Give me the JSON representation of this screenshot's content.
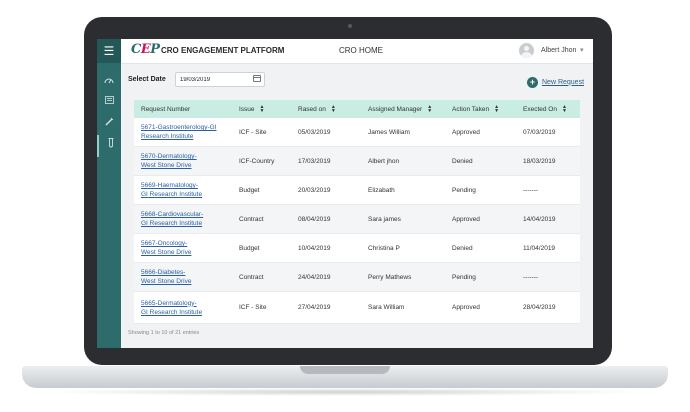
{
  "app": {
    "logo_text": "CEP",
    "brand": "CRO ENGAGEMENT PLATFORM",
    "page_title": "CRO HOME"
  },
  "user": {
    "name": "Albert Jhon"
  },
  "sidebar": {
    "items": [
      {
        "icon": "menu-icon"
      },
      {
        "icon": "speedometer-icon"
      },
      {
        "icon": "list-icon"
      },
      {
        "icon": "syringe-icon"
      },
      {
        "icon": "test-tube-icon"
      }
    ]
  },
  "toolbar": {
    "date_label": "Select Date",
    "date_value": "19/03/2019",
    "new_request_label": "New Request"
  },
  "table": {
    "columns": [
      "Request Number",
      "Issue",
      "Rased on",
      "Assigned Manager",
      "Action Taken",
      "Exected On"
    ],
    "rows": [
      {
        "req1": "5671-Gastroenterology-GI",
        "req2": "Research Institute",
        "issue": "ICF - Site",
        "rased": "05/03/2019",
        "manager": "James William",
        "action": "Approved",
        "exected": "07/03/2019"
      },
      {
        "req1": "5670-Dermatology-",
        "req2": "West Stone Drive",
        "issue": "ICF-Country",
        "rased": "17/03/2019",
        "manager": "Albert jhon",
        "action": "Denied",
        "exected": "18/03/2019"
      },
      {
        "req1": "5669-Haematology-",
        "req2": "GI Research Institute",
        "issue": "Budget",
        "rased": "20/03/2019",
        "manager": "Elizabath",
        "action": "Pending",
        "exected": "-------"
      },
      {
        "req1": "5668-Cardiovascular-",
        "req2": "GI Research Institute",
        "issue": "Contract",
        "rased": "08/04/2019",
        "manager": "Sara james",
        "action": "Approved",
        "exected": "14/04/2019"
      },
      {
        "req1": "5667-Oncology-",
        "req2": "West Stone Drive",
        "issue": "Budget",
        "rased": "10/04/2019",
        "manager": "Christina P",
        "action": "Denied",
        "exected": "11/04/2019"
      },
      {
        "req1": "5666-Diabetes-",
        "req2": "West Stone Drive",
        "issue": "Contract",
        "rased": "24/04/2019",
        "manager": "Perry Mathews",
        "action": "Pending",
        "exected": "-------"
      },
      {
        "req1": "5665-Dermatology-",
        "req2": "GI Research Institute",
        "issue": "ICF - Site",
        "rased": "27/04/2019",
        "manager": "Sara William",
        "action": "Approved",
        "exected": "28/04/2019"
      }
    ],
    "footer": "Showing 1 to 10 of 21 entries"
  }
}
